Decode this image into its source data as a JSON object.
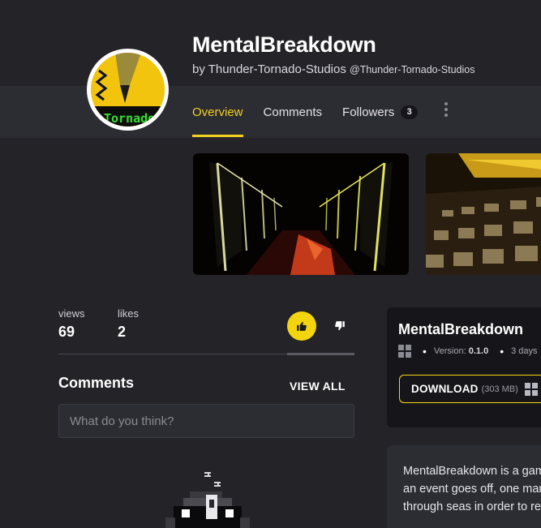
{
  "game": {
    "title": "MentalBreakdown",
    "by_prefix": "by",
    "author": "Thunder-Tornado-Studios",
    "handle": "@Thunder-Tornado-Studios",
    "avatar_text": "Tornado"
  },
  "tabs": [
    {
      "label": "Overview",
      "active": true
    },
    {
      "label": "Comments",
      "active": false
    },
    {
      "label": "Followers",
      "active": false,
      "badge": "3"
    }
  ],
  "stats": {
    "views_label": "views",
    "views_value": "69",
    "likes_label": "likes",
    "likes_value": "2"
  },
  "comments": {
    "heading": "Comments",
    "view_all": "VIEW ALL",
    "placeholder": "What do you think?"
  },
  "panel": {
    "title": "MentalBreakdown",
    "version_label": "Version:",
    "version_value": "0.1.0",
    "date": "3 days",
    "download_label": "DOWNLOAD",
    "download_size": "(303 MB)"
  },
  "description": "MentalBreakdown is a game where after an event goes off, one man goes through seas in order to re",
  "icons": {
    "like": "thumbs-up-icon",
    "dislike": "thumbs-down-icon",
    "more": "kebab-menu-icon",
    "platform": "windows-icon"
  },
  "colors": {
    "accent": "#f2d020",
    "background": "#232328",
    "surface": "#2c2c33",
    "panel": "#16161a"
  }
}
